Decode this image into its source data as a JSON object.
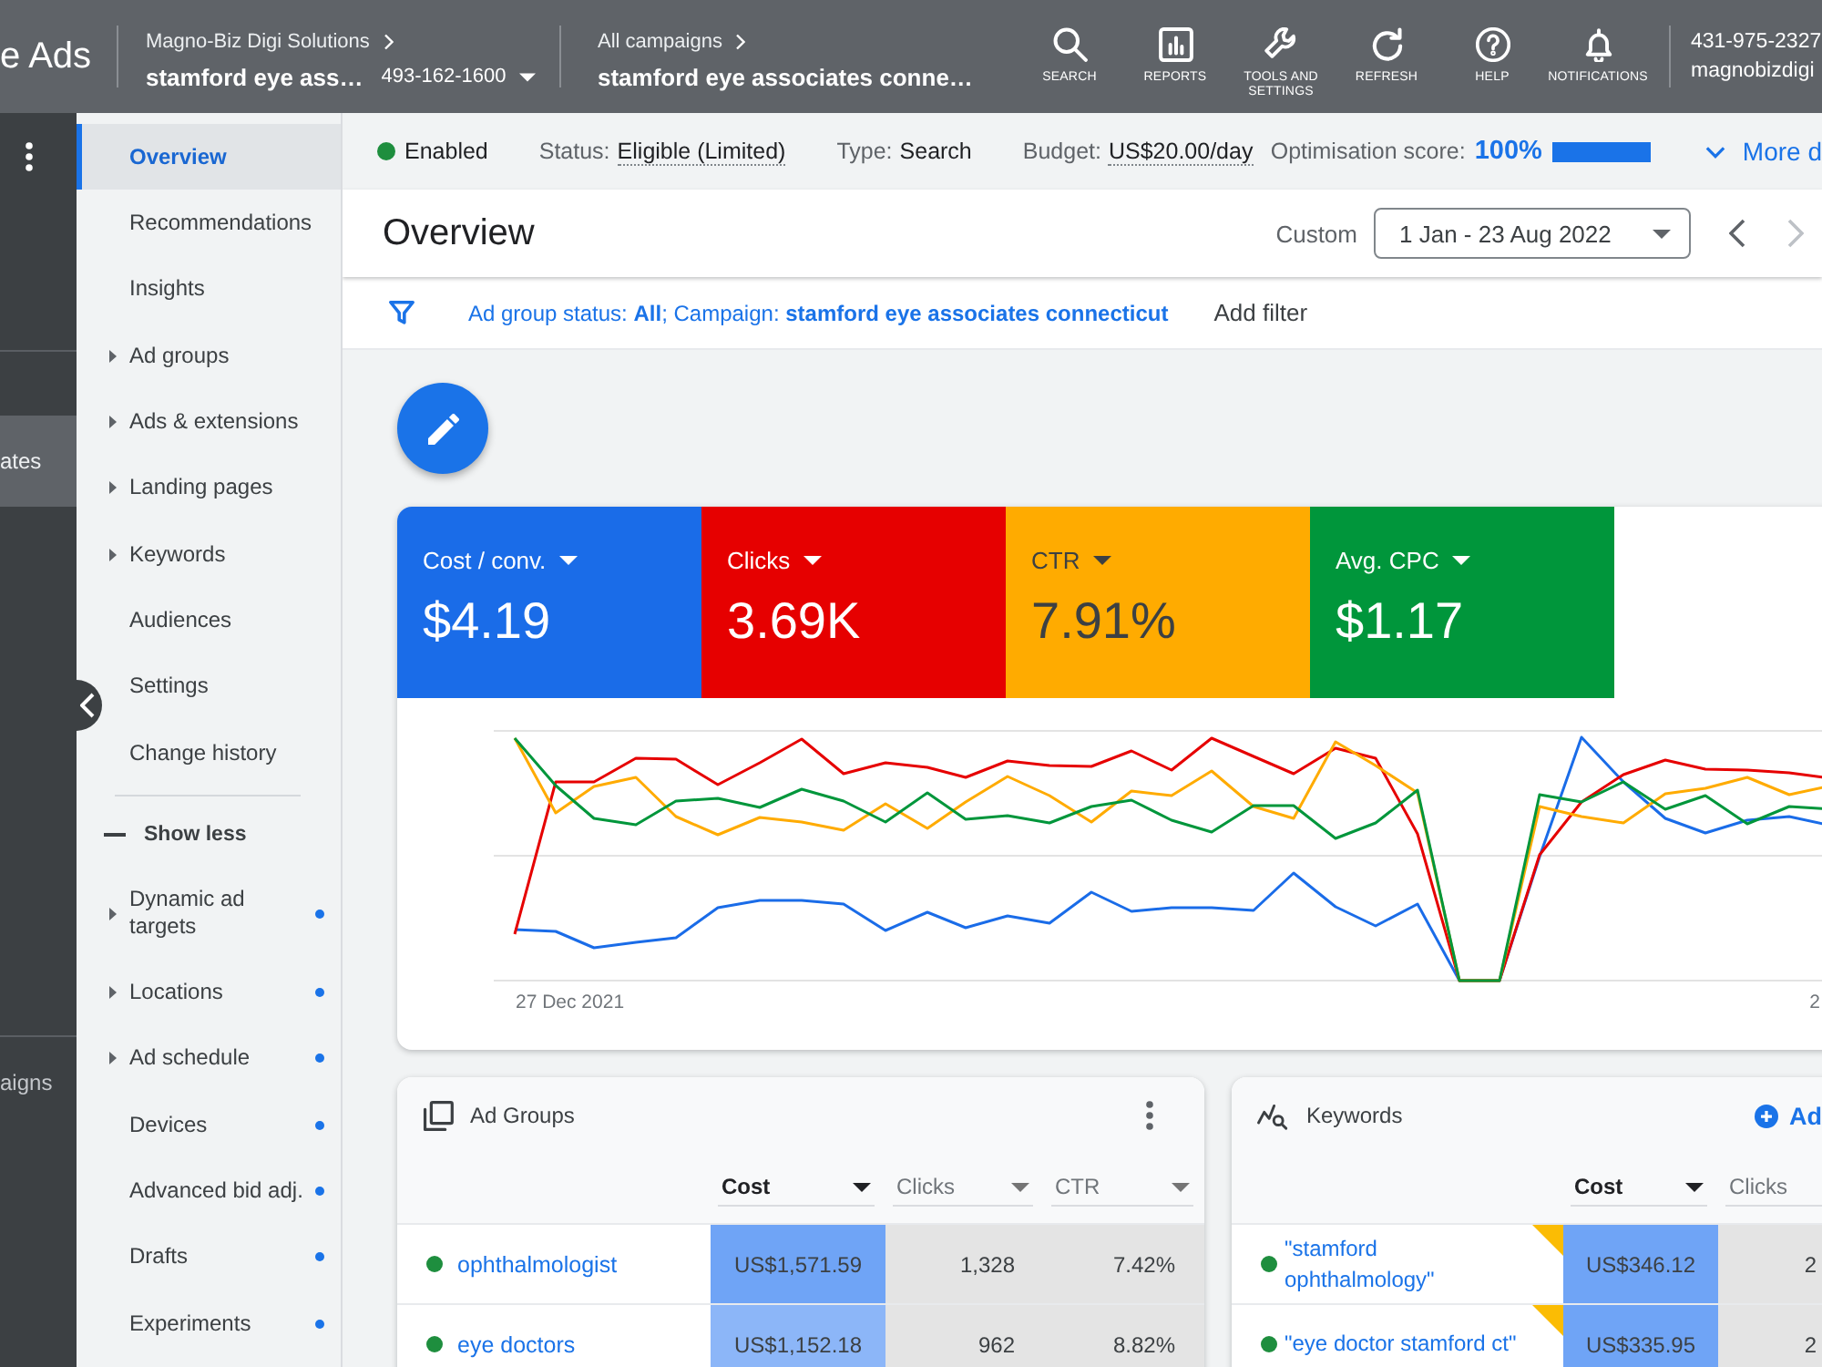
{
  "top_bar": {
    "product": "e Ads",
    "account": {
      "parent": "Magno-Biz Digi Solutions",
      "name": "stamford eye ass…",
      "id": "493-162-1600"
    },
    "campaign": {
      "parent": "All campaigns",
      "name": "stamford eye associates conne…"
    },
    "tools": [
      {
        "kind": "search",
        "label": "SEARCH"
      },
      {
        "kind": "reports",
        "label": "REPORTS"
      },
      {
        "kind": "tools",
        "label": "TOOLS AND SETTINGS"
      },
      {
        "kind": "refresh",
        "label": "REFRESH"
      },
      {
        "kind": "help",
        "label": "HELP"
      },
      {
        "kind": "notifications",
        "label": "NOTIFICATIONS"
      }
    ],
    "user": {
      "phone": "431-975-2327",
      "email": "magnobizdigi"
    }
  },
  "rail": {
    "sections": [
      {
        "items": [
          {
            "label": "ates",
            "selected": true
          }
        ]
      },
      {
        "items": [
          {
            "label": "aigns",
            "selected": false
          }
        ]
      }
    ]
  },
  "nav": {
    "items": [
      {
        "label": "Overview",
        "selected": true,
        "expandable": false,
        "dot": false
      },
      {
        "label": "Recommendations",
        "selected": false,
        "expandable": false,
        "dot": false
      },
      {
        "label": "Insights",
        "selected": false,
        "expandable": false,
        "dot": false
      },
      {
        "label": "Ad groups",
        "selected": false,
        "expandable": true,
        "dot": false
      },
      {
        "label": "Ads & extensions",
        "selected": false,
        "expandable": true,
        "dot": false
      },
      {
        "label": "Landing pages",
        "selected": false,
        "expandable": true,
        "dot": false
      },
      {
        "label": "Keywords",
        "selected": false,
        "expandable": true,
        "dot": false
      },
      {
        "label": "Audiences",
        "selected": false,
        "expandable": false,
        "dot": false
      },
      {
        "label": "Settings",
        "selected": false,
        "expandable": false,
        "dot": false
      },
      {
        "label": "Change history",
        "selected": false,
        "expandable": false,
        "dot": false
      }
    ],
    "toggle": "Show less",
    "extra_items": [
      {
        "label": "Dynamic ad targets",
        "selected": false,
        "expandable": true,
        "dot": true
      },
      {
        "label": "Locations",
        "selected": false,
        "expandable": true,
        "dot": true
      },
      {
        "label": "Ad schedule",
        "selected": false,
        "expandable": true,
        "dot": true
      },
      {
        "label": "Devices",
        "selected": false,
        "expandable": false,
        "dot": true
      },
      {
        "label": "Advanced bid adj.",
        "selected": false,
        "expandable": false,
        "dot": true
      },
      {
        "label": "Drafts",
        "selected": false,
        "expandable": false,
        "dot": true
      },
      {
        "label": "Experiments",
        "selected": false,
        "expandable": false,
        "dot": true
      }
    ]
  },
  "status_bar": {
    "state": {
      "label": "Enabled",
      "enabled": true
    },
    "fields": [
      {
        "label": "Status:",
        "value": "Eligible (Limited)",
        "tooltip": true
      },
      {
        "label": "Type:",
        "value": "Search",
        "tooltip": false
      },
      {
        "label": "Budget:",
        "value": "US$20.00/day",
        "tooltip": true
      }
    ],
    "score": {
      "label": "Optimisation score:",
      "value": "100%",
      "level": 1
    },
    "more": "More d"
  },
  "header": {
    "title": "Overview",
    "range_label": "Custom",
    "date_range": "1 Jan - 23 Aug 2022",
    "pager": [
      {
        "kind": "prev",
        "disabled": false
      },
      {
        "kind": "next",
        "disabled": true
      }
    ]
  },
  "filter": {
    "text": "Ad group status: **All**; Campaign: **stamford eye associates connecticut**",
    "add": "Add filter"
  },
  "metrics": [
    {
      "label": "Cost / conv.",
      "value": "$4.19",
      "color": "#1a6ce8"
    },
    {
      "label": "Clicks",
      "value": "3.69K",
      "color": "#e60000"
    },
    {
      "label": "CTR",
      "value": "7.91%",
      "color": "#ffab00"
    },
    {
      "label": "Avg. CPC",
      "value": "$1.17",
      "color": "#00963b"
    }
  ],
  "chart": {
    "x_labels": [
      "27 Dec 2021",
      "2"
    ]
  },
  "ad_groups": {
    "title": "Ad Groups",
    "columns": [
      {
        "label": "Cost",
        "sorted": true
      },
      {
        "label": "Clicks",
        "sorted": false
      },
      {
        "label": "CTR",
        "sorted": false
      }
    ],
    "rows": [
      {
        "name": "ophthalmologist",
        "enabled": true,
        "cells": [
          {
            "text": "US$1,571.59",
            "color": "#6fa4f6"
          },
          {
            "text": "1,328"
          },
          {
            "text": "7.42%"
          }
        ]
      },
      {
        "name": "eye doctors",
        "enabled": true,
        "cells": [
          {
            "text": "US$1,152.18",
            "color": "#8cb6f8"
          },
          {
            "text": "962"
          },
          {
            "text": "8.82%"
          }
        ]
      }
    ]
  },
  "keywords": {
    "title": "Keywords",
    "add": "Ad",
    "columns": [
      {
        "label": "Cost",
        "sorted": true
      },
      {
        "label": "Clicks",
        "sorted": false
      }
    ],
    "rows": [
      {
        "text": "\"stamford ophthalmology\"",
        "enabled": true,
        "flagged": true,
        "cells": [
          {
            "text": "US$346.12",
            "color": "#6fa4f6"
          },
          {
            "text": "2"
          }
        ]
      },
      {
        "text": "\"eye doctor stamford ct\"",
        "enabled": true,
        "flagged": true,
        "cells": [
          {
            "text": "US$335.95",
            "color": "#6fa4f6"
          },
          {
            "text": "2"
          }
        ]
      }
    ]
  }
}
